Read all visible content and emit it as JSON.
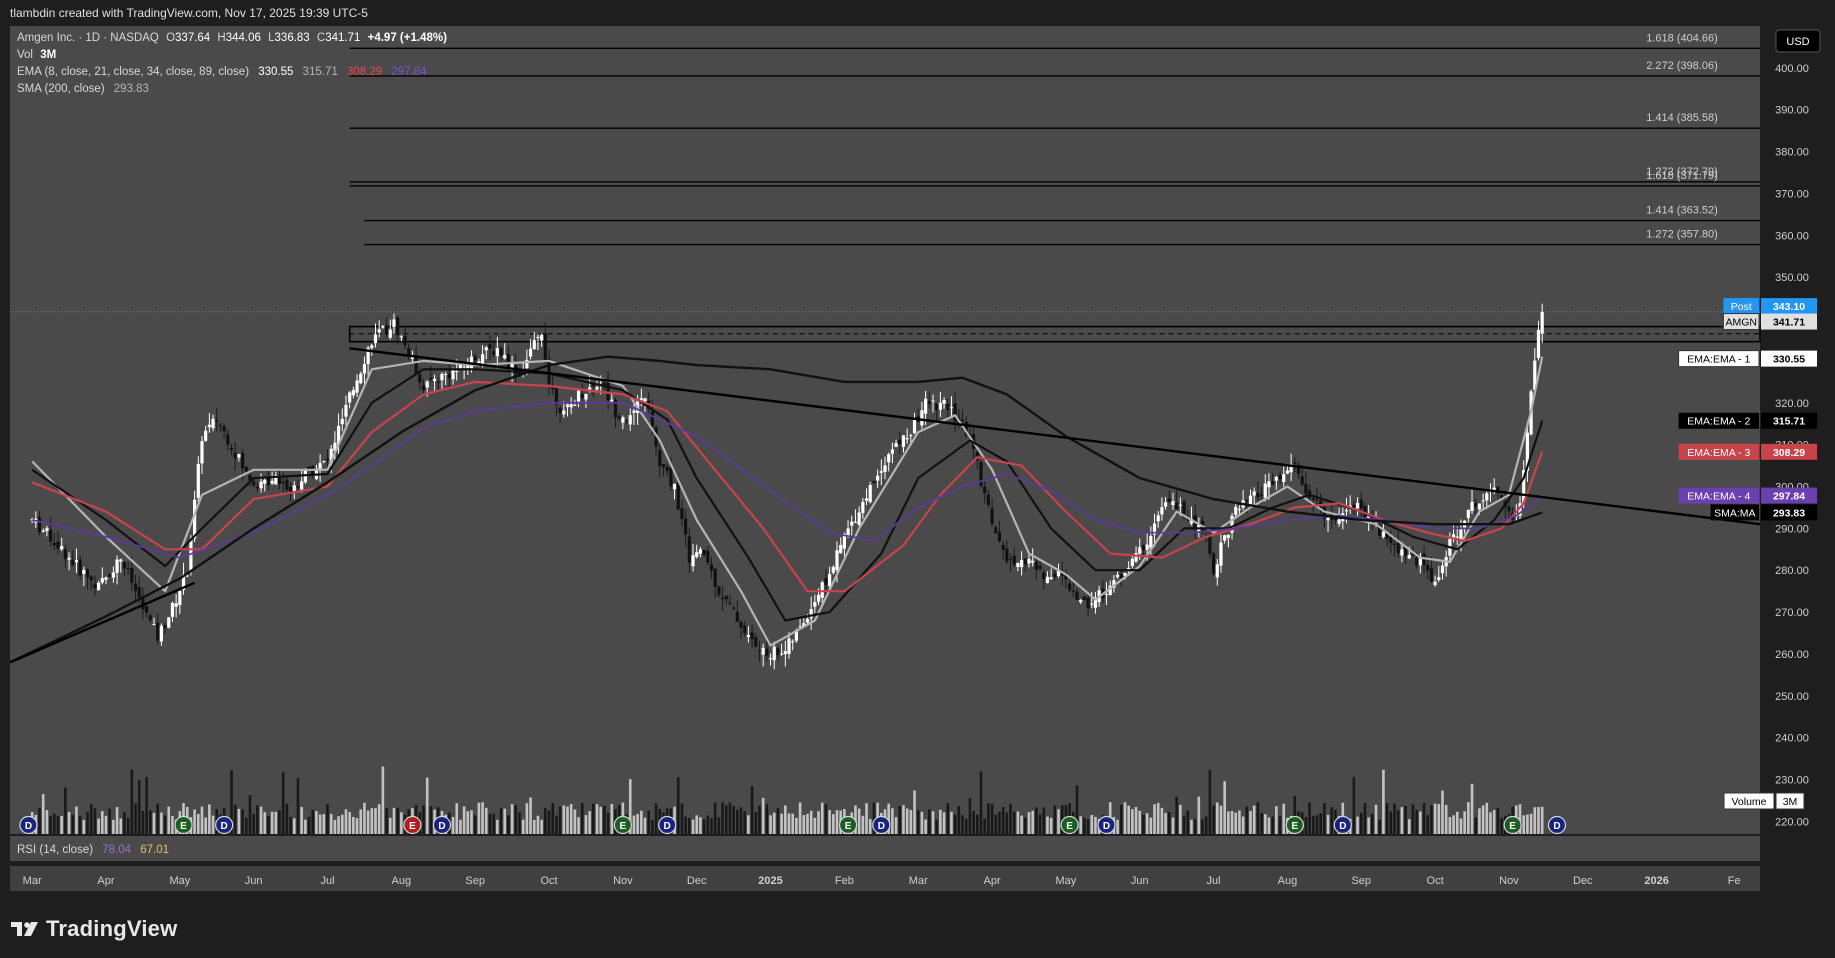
{
  "header": {
    "caption": "tlambdin created with TradingView.com, Nov 17, 2025 19:39 UTC-5"
  },
  "legend": {
    "symbol": "Amgen Inc. · 1D · NASDAQ",
    "o_label": "O",
    "o_value": "337.64",
    "h_label": "H",
    "h_value": "344.06",
    "l_label": "L",
    "l_value": "336.83",
    "c_label": "C",
    "c_value": "341.71",
    "change": "+4.97 (+1.48%)",
    "vol_label": "Vol",
    "vol_value": "3M",
    "ema_label": "EMA (8, close, 21, close, 34, close, 89, close)",
    "ema_values": [
      "330.55",
      "315.71",
      "308.29",
      "297.84"
    ],
    "sma_label": "SMA (200, close)",
    "sma_value": "293.83",
    "rsi_label": "RSI (14, close)",
    "rsi_values": [
      "78.04",
      "67.01"
    ]
  },
  "currency": "USD",
  "footer": {
    "brand": "TradingView"
  },
  "colors": {
    "background": "#4a4a4a",
    "axis_bg": "#1e1e1e",
    "ema8": "#b4b4b4",
    "ema21": "#111111",
    "ema34": "#c8434a",
    "ema89": "#5a3a9a",
    "sma200": "#111111",
    "post": "#2196f3",
    "trendline": "#000000"
  },
  "chart_data": {
    "type": "candlestick",
    "title": "Amgen Inc. · 1D · NASDAQ",
    "ylim": [
      217,
      410
    ],
    "y_ticks": [
      400,
      390,
      380,
      370,
      360,
      350,
      340,
      330,
      320,
      310,
      300,
      290,
      280,
      270,
      260,
      250,
      240,
      230,
      220
    ],
    "y_tick_labels": [
      "400.00",
      "390.00",
      "380.00",
      "370.00",
      "360.00",
      "350.00",
      "340.00",
      "330.00",
      "320.00",
      "310.00",
      "300.00",
      "290.00",
      "280.00",
      "270.00",
      "260.00",
      "250.00",
      "240.00",
      "230.00",
      "220.00"
    ],
    "x_labels": [
      "Mar",
      "Apr",
      "May",
      "Jun",
      "Jul",
      "Aug",
      "Sep",
      "Oct",
      "Nov",
      "Dec",
      "2025",
      "Feb",
      "Mar",
      "Apr",
      "May",
      "Jun",
      "Jul",
      "Aug",
      "Sep",
      "Oct",
      "Nov",
      "Dec",
      "2026",
      "Fe"
    ],
    "x_label_months": [
      0,
      1,
      2,
      3,
      4,
      5,
      6,
      7,
      8,
      9,
      10,
      11,
      12,
      13,
      14,
      15,
      16,
      17,
      18,
      19,
      20,
      21,
      22,
      23.05
    ],
    "months_visible": [
      -0.3,
      23.4
    ],
    "last_month_position": 20.45,
    "price_path": [
      [
        0,
        292
      ],
      [
        0.3,
        287
      ],
      [
        0.6,
        281
      ],
      [
        0.9,
        276
      ],
      [
        1.2,
        283
      ],
      [
        1.5,
        271
      ],
      [
        1.7,
        264
      ],
      [
        1.9,
        271
      ],
      [
        2.1,
        280
      ],
      [
        2.3,
        312
      ],
      [
        2.5,
        316
      ],
      [
        2.7,
        310
      ],
      [
        2.9,
        303
      ],
      [
        3.1,
        300
      ],
      [
        3.3,
        303
      ],
      [
        3.5,
        299
      ],
      [
        3.7,
        303
      ],
      [
        4.0,
        306
      ],
      [
        4.2,
        316
      ],
      [
        4.4,
        326
      ],
      [
        4.6,
        335
      ],
      [
        4.9,
        339
      ],
      [
        5.1,
        332
      ],
      [
        5.3,
        324
      ],
      [
        5.5,
        326
      ],
      [
        5.8,
        328
      ],
      [
        6.0,
        331
      ],
      [
        6.3,
        333
      ],
      [
        6.6,
        327
      ],
      [
        6.9,
        337
      ],
      [
        7.0,
        325
      ],
      [
        7.2,
        317
      ],
      [
        7.4,
        322
      ],
      [
        7.7,
        325
      ],
      [
        7.9,
        318
      ],
      [
        8.1,
        316
      ],
      [
        8.3,
        322
      ],
      [
        8.5,
        305
      ],
      [
        8.7,
        300
      ],
      [
        8.9,
        283
      ],
      [
        9.1,
        284
      ],
      [
        9.3,
        275
      ],
      [
        9.5,
        270
      ],
      [
        9.7,
        264
      ],
      [
        9.9,
        260
      ],
      [
        10.2,
        261
      ],
      [
        10.4,
        266
      ],
      [
        10.6,
        273
      ],
      [
        10.8,
        279
      ],
      [
        11.0,
        288
      ],
      [
        11.3,
        298
      ],
      [
        11.6,
        308
      ],
      [
        11.9,
        313
      ],
      [
        12.1,
        320
      ],
      [
        12.4,
        319
      ],
      [
        12.7,
        312
      ],
      [
        12.9,
        298
      ],
      [
        13.1,
        286
      ],
      [
        13.3,
        280
      ],
      [
        13.5,
        283
      ],
      [
        13.7,
        278
      ],
      [
        13.9,
        280
      ],
      [
        14.1,
        274
      ],
      [
        14.3,
        272
      ],
      [
        14.6,
        276
      ],
      [
        14.9,
        282
      ],
      [
        15.1,
        287
      ],
      [
        15.3,
        295
      ],
      [
        15.5,
        296
      ],
      [
        15.7,
        291
      ],
      [
        15.9,
        289
      ],
      [
        16.0,
        279
      ],
      [
        16.1,
        286
      ],
      [
        16.3,
        294
      ],
      [
        16.6,
        298
      ],
      [
        16.9,
        302
      ],
      [
        17.1,
        305
      ],
      [
        17.3,
        297
      ],
      [
        17.6,
        292
      ],
      [
        17.9,
        296
      ],
      [
        18.1,
        293
      ],
      [
        18.3,
        288
      ],
      [
        18.6,
        284
      ],
      [
        18.8,
        282
      ],
      [
        19.0,
        277
      ],
      [
        19.2,
        286
      ],
      [
        19.4,
        293
      ],
      [
        19.6,
        297
      ],
      [
        19.8,
        301
      ],
      [
        20.0,
        295
      ],
      [
        20.1,
        292
      ],
      [
        20.2,
        303
      ],
      [
        20.3,
        322
      ],
      [
        20.4,
        338
      ],
      [
        20.45,
        342
      ]
    ],
    "series": [
      {
        "name": "EMA 8",
        "path": [
          [
            0,
            306
          ],
          [
            1,
            288
          ],
          [
            1.8,
            275
          ],
          [
            2.3,
            298
          ],
          [
            3,
            304
          ],
          [
            4,
            304
          ],
          [
            4.6,
            328
          ],
          [
            5.3,
            330
          ],
          [
            6,
            329
          ],
          [
            7,
            330
          ],
          [
            8,
            324
          ],
          [
            8.5,
            311
          ],
          [
            9,
            292
          ],
          [
            9.6,
            275
          ],
          [
            10,
            262
          ],
          [
            10.6,
            268
          ],
          [
            11.2,
            290
          ],
          [
            12,
            313
          ],
          [
            12.5,
            317
          ],
          [
            13,
            304
          ],
          [
            13.5,
            284
          ],
          [
            14,
            279
          ],
          [
            14.4,
            273
          ],
          [
            15,
            281
          ],
          [
            15.5,
            294
          ],
          [
            16,
            289
          ],
          [
            16.5,
            295
          ],
          [
            17,
            300
          ],
          [
            17.5,
            294
          ],
          [
            18.2,
            291
          ],
          [
            18.8,
            283
          ],
          [
            19.2,
            282
          ],
          [
            19.6,
            294
          ],
          [
            20,
            298
          ],
          [
            20.3,
            318
          ],
          [
            20.45,
            331
          ]
        ]
      },
      {
        "name": "EMA 21",
        "path": [
          [
            0,
            304
          ],
          [
            1,
            292
          ],
          [
            1.8,
            281
          ],
          [
            2.3,
            290
          ],
          [
            3,
            302
          ],
          [
            4,
            303
          ],
          [
            4.6,
            320
          ],
          [
            5.3,
            328
          ],
          [
            6,
            328
          ],
          [
            7,
            327
          ],
          [
            8,
            323
          ],
          [
            8.6,
            316
          ],
          [
            9,
            302
          ],
          [
            9.7,
            283
          ],
          [
            10.2,
            268
          ],
          [
            10.8,
            270
          ],
          [
            11.5,
            284
          ],
          [
            12,
            302
          ],
          [
            12.7,
            311
          ],
          [
            13.2,
            306
          ],
          [
            13.8,
            290
          ],
          [
            14.4,
            280
          ],
          [
            15,
            280
          ],
          [
            15.6,
            290
          ],
          [
            16.2,
            290
          ],
          [
            16.8,
            295
          ],
          [
            17.3,
            298
          ],
          [
            18,
            294
          ],
          [
            18.7,
            288
          ],
          [
            19.3,
            285
          ],
          [
            19.8,
            292
          ],
          [
            20.2,
            302
          ],
          [
            20.45,
            315.7
          ]
        ]
      },
      {
        "name": "EMA 34",
        "path": [
          [
            0,
            301
          ],
          [
            1,
            294
          ],
          [
            1.8,
            285
          ],
          [
            2.3,
            285
          ],
          [
            3,
            297
          ],
          [
            4,
            300
          ],
          [
            4.6,
            313
          ],
          [
            5.3,
            322
          ],
          [
            6,
            325
          ],
          [
            7,
            324
          ],
          [
            8,
            322
          ],
          [
            8.6,
            318
          ],
          [
            9.2,
            305
          ],
          [
            9.9,
            290
          ],
          [
            10.5,
            275
          ],
          [
            11,
            275
          ],
          [
            11.8,
            286
          ],
          [
            12.3,
            298
          ],
          [
            12.8,
            307
          ],
          [
            13.4,
            305
          ],
          [
            14,
            294
          ],
          [
            14.6,
            284
          ],
          [
            15.3,
            283
          ],
          [
            15.9,
            288
          ],
          [
            16.5,
            291
          ],
          [
            17.1,
            295
          ],
          [
            17.7,
            296
          ],
          [
            18.3,
            292
          ],
          [
            18.9,
            289
          ],
          [
            19.4,
            287
          ],
          [
            19.9,
            290
          ],
          [
            20.2,
            296
          ],
          [
            20.45,
            308.3
          ]
        ]
      },
      {
        "name": "EMA 89",
        "path": [
          [
            0,
            292
          ],
          [
            1,
            288
          ],
          [
            2,
            283
          ],
          [
            3,
            289
          ],
          [
            4,
            298
          ],
          [
            4.6,
            305
          ],
          [
            5.3,
            314
          ],
          [
            6,
            318
          ],
          [
            7,
            320
          ],
          [
            8,
            320
          ],
          [
            9,
            312
          ],
          [
            10,
            299
          ],
          [
            10.8,
            289
          ],
          [
            11.4,
            287
          ],
          [
            12,
            295
          ],
          [
            12.6,
            300
          ],
          [
            13.2,
            303
          ],
          [
            13.8,
            299
          ],
          [
            14.4,
            292
          ],
          [
            15,
            289
          ],
          [
            15.7,
            289
          ],
          [
            16.3,
            290
          ],
          [
            17,
            292
          ],
          [
            17.7,
            293
          ],
          [
            18.3,
            292
          ],
          [
            19,
            290
          ],
          [
            19.6,
            290
          ],
          [
            20.1,
            293
          ],
          [
            20.45,
            297.8
          ]
        ]
      },
      {
        "name": "SMA 200",
        "path": [
          [
            -0.3,
            258
          ],
          [
            1,
            269
          ],
          [
            2,
            278
          ],
          [
            3,
            290
          ],
          [
            4,
            301
          ],
          [
            5,
            313
          ],
          [
            6,
            323
          ],
          [
            7,
            329
          ],
          [
            7.8,
            331
          ],
          [
            8.5,
            330
          ],
          [
            9,
            329
          ],
          [
            10,
            328
          ],
          [
            11,
            325
          ],
          [
            12,
            325
          ],
          [
            12.6,
            326
          ],
          [
            13.2,
            322
          ],
          [
            14,
            312
          ],
          [
            15,
            302
          ],
          [
            16,
            297
          ],
          [
            17,
            294
          ],
          [
            18,
            292
          ],
          [
            19,
            291
          ],
          [
            20,
            291
          ],
          [
            20.45,
            293.8
          ]
        ]
      }
    ],
    "trendlines": [
      {
        "name": "descending",
        "path": [
          [
            4.3,
            333
          ],
          [
            23.4,
            291
          ]
        ]
      },
      {
        "name": "ascending",
        "path": [
          [
            -0.3,
            258
          ],
          [
            2.2,
            277
          ]
        ]
      }
    ],
    "fib_levels": [
      {
        "label": "1.618 (404.66)",
        "value": 404.66,
        "start": 4.3
      },
      {
        "label": "2.272 (398.06)",
        "value": 398.06,
        "start": 4.3
      },
      {
        "label": "1.414 (385.58)",
        "value": 385.58,
        "start": 4.3
      },
      {
        "label": "1.272 (372.79)",
        "value": 372.79,
        "start": 4.3
      },
      {
        "label": "1.618 (371.79)",
        "value": 371.79,
        "start": 4.3
      },
      {
        "label": "1.414 (363.52)",
        "value": 363.52,
        "start": 4.5
      },
      {
        "label": "1.272 (357.80)",
        "value": 357.8,
        "start": 4.5
      }
    ],
    "resistance_zone": {
      "top": 338.2,
      "bottom": 334.6,
      "mid": 336.5,
      "start": 4.3
    },
    "current_price": 341.71,
    "post_price": 343.1,
    "price_tags": [
      {
        "label": "Post",
        "value": "343.10",
        "y": 343.1,
        "color": "#2196f3"
      },
      {
        "label": "AMGN",
        "value": "341.71",
        "y": 339.4,
        "color": "#e0e0e0"
      },
      {
        "label": "EMA:EMA - 1",
        "value": "330.55",
        "y": 330.55,
        "color": "#ffffff"
      },
      {
        "label": "EMA:EMA - 2",
        "value": "315.71",
        "y": 315.71,
        "color": "#000000"
      },
      {
        "label": "EMA:EMA - 3",
        "value": "308.29",
        "y": 308.29,
        "color": "#c8434a"
      },
      {
        "label": "EMA:EMA - 4",
        "value": "297.84",
        "y": 297.84,
        "color": "#6a3fb0"
      },
      {
        "label": "SMA:MA",
        "value": "293.83",
        "y": 293.83,
        "color": "#000000"
      }
    ],
    "volume_tag": {
      "label": "Volume",
      "value": "3M"
    },
    "events": [
      {
        "type": "D",
        "month": -0.05
      },
      {
        "type": "E",
        "month": 2.05
      },
      {
        "type": "D",
        "month": 2.6
      },
      {
        "type": "E",
        "month": 5.15,
        "red": true
      },
      {
        "type": "D",
        "month": 5.55
      },
      {
        "type": "E",
        "month": 8.0
      },
      {
        "type": "D",
        "month": 8.6
      },
      {
        "type": "E",
        "month": 11.05
      },
      {
        "type": "D",
        "month": 11.5
      },
      {
        "type": "E",
        "month": 14.05
      },
      {
        "type": "D",
        "month": 14.55
      },
      {
        "type": "E",
        "month": 17.1
      },
      {
        "type": "D",
        "month": 17.75
      },
      {
        "type": "E",
        "month": 20.05
      },
      {
        "type": "D",
        "month": 20.65
      }
    ]
  }
}
